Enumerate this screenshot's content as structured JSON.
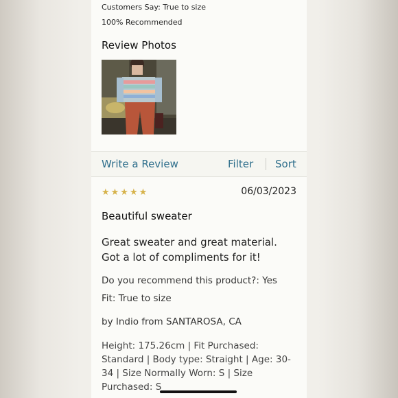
{
  "summary": {
    "customers_say": "Customers Say: True to size",
    "recommended": "100% Recommended"
  },
  "review_photos": {
    "heading": "Review Photos",
    "photos": [
      {
        "alt": ""
      }
    ]
  },
  "action_bar": {
    "write_review": "Write a Review",
    "filter": "Filter",
    "sort": "Sort"
  },
  "review": {
    "stars": "★★★★★",
    "rating": 5,
    "date": "06/03/2023",
    "title": "Beautiful sweater",
    "body": "Great sweater and great material. Got a lot of compliments for it!",
    "recommend": "Do you recommend this product?: Yes",
    "fit": "Fit: True to size",
    "author": "by Indio from SANTAROSA, CA",
    "attributes": "Height: 175.26cm  |  Fit Purchased: Standard  |  Body type: Straight  |  Age: 30-34  |  Size Normally Worn: S  |  Size Purchased: S"
  },
  "colors": {
    "link": "#2f6f8c",
    "star": "#d6b24a",
    "panel_bg": "#fbfbf8"
  }
}
